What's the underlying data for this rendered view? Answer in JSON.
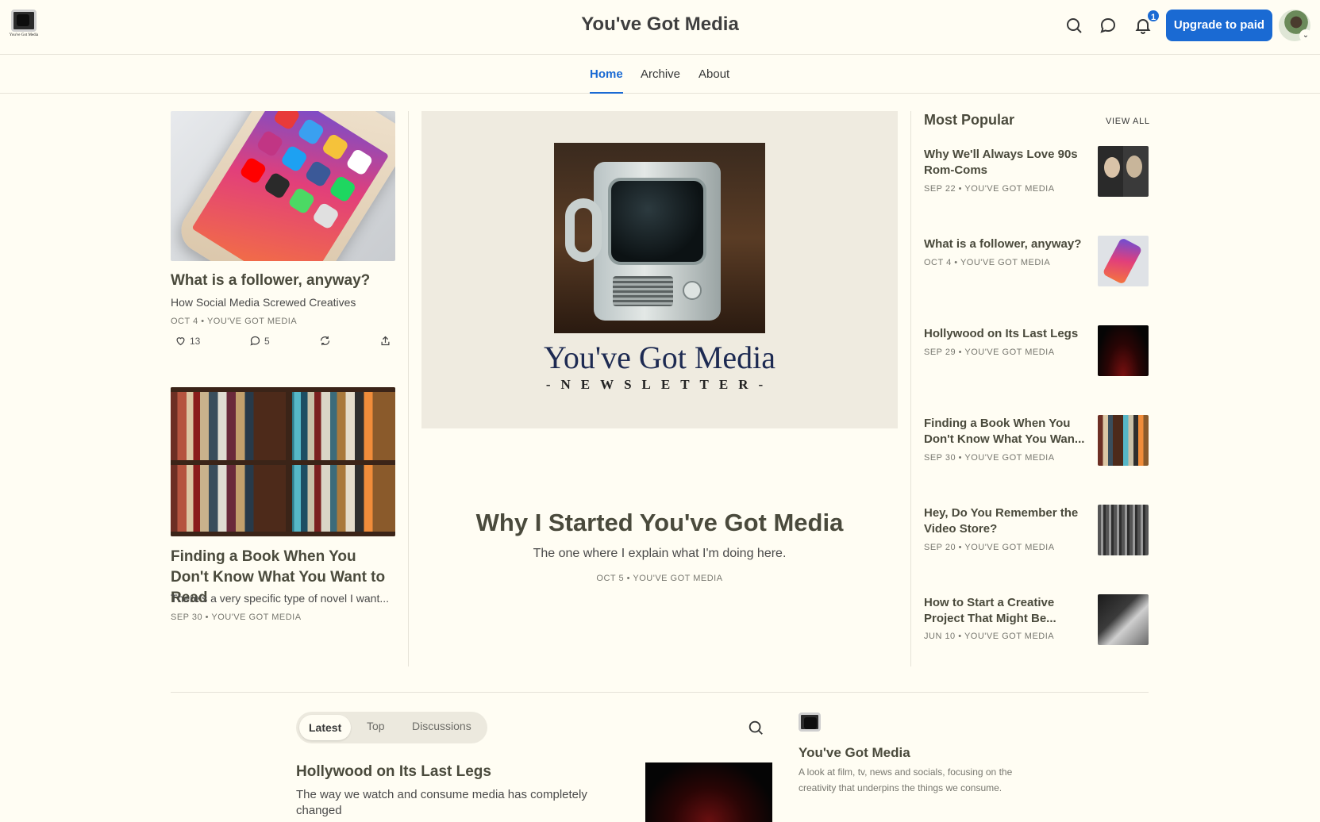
{
  "header": {
    "logo_text": "You've Got Media",
    "site_title": "You've Got Media",
    "notification_count": "1",
    "upgrade_label": "Upgrade to paid"
  },
  "nav": {
    "tabs": [
      {
        "label": "Home",
        "active": true
      },
      {
        "label": "Archive",
        "active": false
      },
      {
        "label": "About",
        "active": false
      }
    ]
  },
  "left_posts": [
    {
      "title": "What is a follower, anyway?",
      "subtitle": "How Social Media Screwed Creatives",
      "meta": "OCT 4 • YOU'VE GOT MEDIA",
      "likes": "13",
      "comments": "5"
    },
    {
      "title": "Finding a Book When You Don't Know What You Want to Read",
      "subtitle": "There's a very specific type of novel I want...",
      "meta": "SEP 30 • YOU'VE GOT MEDIA"
    }
  ],
  "hero": {
    "image_brand": "You've Got Media",
    "image_brand_sub": "-NEWSLETTER-",
    "title": "Why I Started You've Got Media",
    "subtitle": "The one where I explain what I'm doing here.",
    "meta": "OCT 5 • YOU'VE GOT MEDIA"
  },
  "most_popular": {
    "heading": "Most Popular",
    "view_all": "VIEW ALL",
    "items": [
      {
        "title": "Why We'll Always Love 90s Rom-Coms",
        "meta": "SEP 22 • YOU'VE GOT MEDIA"
      },
      {
        "title": "What is a follower, anyway?",
        "meta": "OCT 4 • YOU'VE GOT MEDIA"
      },
      {
        "title": "Hollywood on Its Last Legs",
        "meta": "SEP 29 • YOU'VE GOT MEDIA"
      },
      {
        "title": "Finding a Book When You Don't Know What You Wan...",
        "meta": "SEP 30 • YOU'VE GOT MEDIA"
      },
      {
        "title": "Hey, Do You Remember the Video Store?",
        "meta": "SEP 20 • YOU'VE GOT MEDIA"
      },
      {
        "title": "How to Start a Creative Project That Might Be...",
        "meta": "JUN 10 • YOU'VE GOT MEDIA"
      }
    ]
  },
  "feed": {
    "tabs": [
      {
        "label": "Latest",
        "active": true
      },
      {
        "label": "Top",
        "active": false
      },
      {
        "label": "Discussions",
        "active": false
      }
    ],
    "post": {
      "title": "Hollywood on Its Last Legs",
      "subtitle": "The way we watch and consume media has completely changed"
    }
  },
  "publication": {
    "name": "You've Got Media",
    "description": "A look at film, tv, news and socials, focusing on the creativity that underpins the things we consume."
  },
  "colors": {
    "background": "#fffdf3",
    "accent": "#1a6ad3",
    "text": "#363737"
  }
}
